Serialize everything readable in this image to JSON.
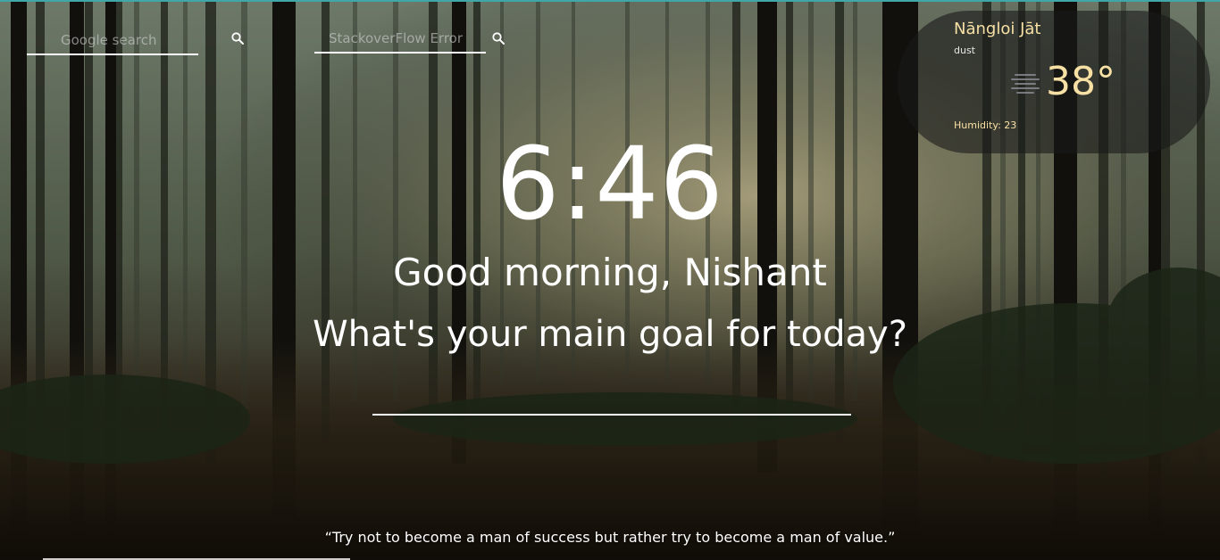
{
  "background": {
    "description_icon": "forest-background",
    "accent_color": "#3fa7a8"
  },
  "search": {
    "google": {
      "placeholder": "Google search",
      "icon": "search-icon"
    },
    "stackoverflow": {
      "placeholder": "StackoverFlow Error",
      "icon": "search-icon"
    }
  },
  "weather": {
    "city": "Nāngloi Jāt",
    "condition": "dust",
    "icon": "haze-icon",
    "temperature": "38°",
    "humidity": "Humidity: 23",
    "accent_color": "#f7e0a4"
  },
  "main": {
    "time": "6:46",
    "greeting": "Good morning, Nishant",
    "question": "What's your main goal for today?",
    "goal_value": ""
  },
  "quote": {
    "text": "“Try not to become a man of success but rather try to become a man of value.”"
  }
}
